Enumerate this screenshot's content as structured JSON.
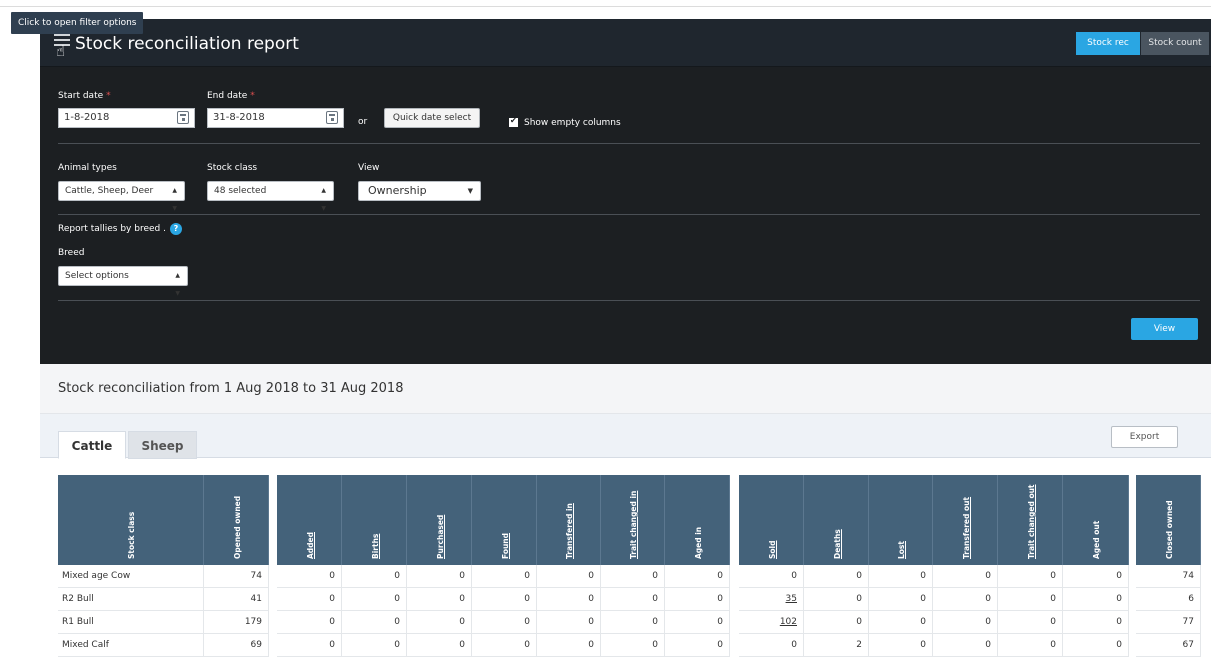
{
  "tooltip": "Click to open filter options",
  "header": {
    "title": "Stock reconciliation report",
    "stock_rec_label": "Stock rec",
    "stock_count_label": "Stock count"
  },
  "filters": {
    "start_date_label": "Start date",
    "start_date_value": "1-8-2018",
    "end_date_label": "End date",
    "end_date_value": "31-8-2018",
    "required_mark": "*",
    "or_label": "or",
    "quick_date_select_label": "Quick date select",
    "show_empty_columns_label": "Show empty columns",
    "show_empty_columns_checked": true,
    "animal_types_label": "Animal types",
    "animal_types_value": "Cattle, Sheep, Deer",
    "stock_class_label": "Stock class",
    "stock_class_value": "48 selected",
    "view_label": "View",
    "view_value": "Ownership",
    "report_tallies_label": "Report tallies by breed .",
    "breed_label": "Breed",
    "breed_placeholder": "Select options",
    "view_button_label": "View"
  },
  "summary": "Stock reconciliation from 1 Aug 2018 to 31 Aug 2018",
  "tabs": [
    "Cattle",
    "Sheep"
  ],
  "export_label": "Export",
  "table": {
    "columns": [
      "Stock class",
      "Opened owned",
      "Added",
      "Births",
      "Purchased",
      "Found",
      "Transfered in",
      "Trait changed in",
      "Aged in",
      "Sold",
      "Deaths",
      "Lost",
      "Transfered out",
      "Trait changed out",
      "Aged out",
      "Closed owned"
    ],
    "rows": [
      [
        "Mixed age Cow",
        "74",
        "0",
        "0",
        "0",
        "0",
        "0",
        "0",
        "0",
        "0",
        "0",
        "0",
        "0",
        "0",
        "0",
        "74"
      ],
      [
        "R2 Bull",
        "41",
        "0",
        "0",
        "0",
        "0",
        "0",
        "0",
        "0",
        "35",
        "0",
        "0",
        "0",
        "0",
        "0",
        "6"
      ],
      [
        "R1 Bull",
        "179",
        "0",
        "0",
        "0",
        "0",
        "0",
        "0",
        "0",
        "102",
        "0",
        "0",
        "0",
        "0",
        "0",
        "77"
      ],
      [
        "Mixed Calf",
        "69",
        "0",
        "0",
        "0",
        "0",
        "0",
        "0",
        "0",
        "0",
        "2",
        "0",
        "0",
        "0",
        "0",
        "67"
      ]
    ]
  },
  "colors": {
    "accent": "#2aa6e3",
    "panel_bg": "#1c1f22",
    "table_header_bg": "#44627a"
  }
}
